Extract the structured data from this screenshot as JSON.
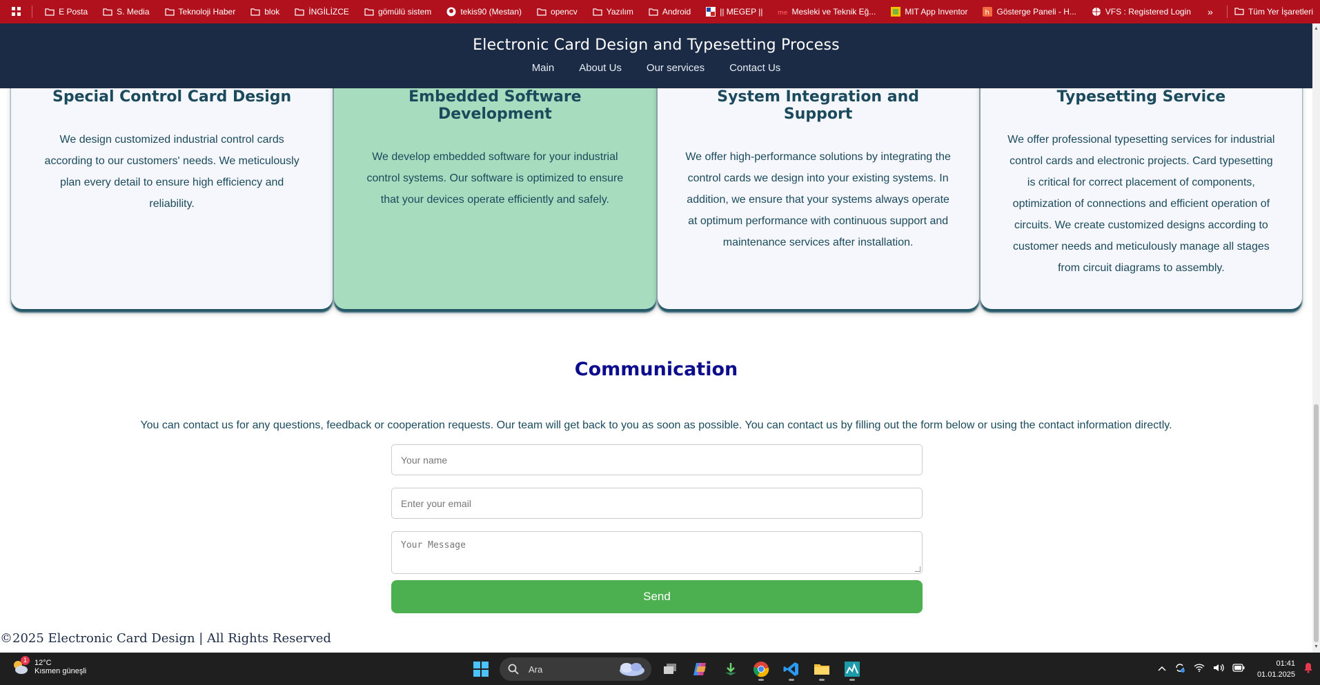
{
  "bookmarks": {
    "items": [
      {
        "label": "E Posta",
        "icon": "folder-icon"
      },
      {
        "label": "S. Media",
        "icon": "folder-icon"
      },
      {
        "label": "Teknoloji Haber",
        "icon": "folder-icon"
      },
      {
        "label": "blok",
        "icon": "folder-icon"
      },
      {
        "label": "İNGİLİZCE",
        "icon": "folder-icon"
      },
      {
        "label": "gömülü sistem",
        "icon": "folder-icon"
      },
      {
        "label": "tekis90 (Mestan)",
        "icon": "github-icon"
      },
      {
        "label": "opencv",
        "icon": "folder-icon"
      },
      {
        "label": "Yazılım",
        "icon": "folder-icon"
      },
      {
        "label": "Android",
        "icon": "folder-icon"
      },
      {
        "label": "|| MEGEP ||",
        "icon": "megep-icon"
      },
      {
        "label": "Mesleki ve Teknik Eğ...",
        "icon": "meb-icon"
      },
      {
        "label": "MIT App Inventor",
        "icon": "app-inventor-icon"
      },
      {
        "label": "Gösterge Paneli - H...",
        "icon": "h-icon"
      },
      {
        "label": "VFS : Registered Login",
        "icon": "globe-icon"
      }
    ],
    "all_bookmarks": "Tüm Yer İşaretleri"
  },
  "header": {
    "title": "Electronic Card Design and Typesetting Process",
    "nav": [
      "Main",
      "About Us",
      "Our services",
      "Contact Us"
    ]
  },
  "services": [
    {
      "title": "Special Control Card Design",
      "text": "We design customized industrial control cards according to our customers' needs. We meticulously plan every detail to ensure high efficiency and reliability."
    },
    {
      "title": "Embedded Software Development",
      "text": "We develop embedded software for your industrial control systems. Our software is optimized to ensure that your devices operate efficiently and safely."
    },
    {
      "title": "System Integration and Support",
      "text": "We offer high-performance solutions by integrating the control cards we design into your existing systems. In addition, we ensure that your systems always operate at optimum performance with continuous support and maintenance services after installation."
    },
    {
      "title": "Typesetting Service",
      "text": "We offer professional typesetting services for industrial control cards and electronic projects. Card typesetting is critical for correct placement of components, optimization of connections and efficient operation of circuits. We create customized designs according to customer needs and meticulously manage all stages from circuit diagrams to assembly."
    }
  ],
  "communication": {
    "title": "Communication",
    "description": "You can contact us for any questions, feedback or cooperation requests. Our team will get back to you as soon as possible. You can contact us by filling out the form below or using the contact information directly.",
    "name_placeholder": "Your name",
    "email_placeholder": "Enter your email",
    "message_placeholder": "Your Message",
    "send_label": "Send"
  },
  "footer": {
    "text": "©2025 Electronic Card Design | All Rights Reserved"
  },
  "taskbar": {
    "weather_temp": "12°C",
    "weather_desc": "Kısmen güneşli",
    "weather_badge": "1",
    "search_label": "Ara",
    "time": "01:41",
    "date": "01.01.2025"
  },
  "colors": {
    "bookmark_bar": "#b0111c",
    "header_bg": "#1c2b45",
    "card_bg": "#f5f7fc",
    "card_active_bg": "#a8dcbe",
    "heading_text": "#1b4a5c",
    "communication_title": "#0c0c8c",
    "send_button": "#4caf50"
  }
}
